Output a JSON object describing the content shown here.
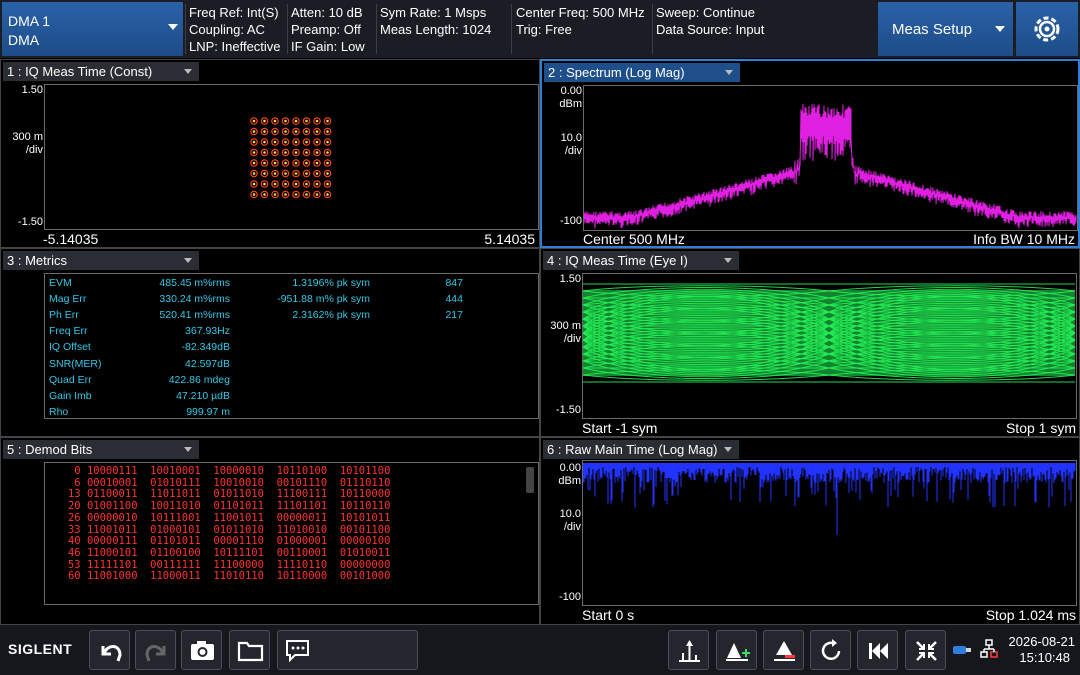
{
  "topbar": {
    "mode_line1": "DMA 1",
    "mode_line2": "DMA",
    "info": [
      [
        "Freq Ref: Int(S)",
        "Coupling: AC",
        "LNP: Ineffective"
      ],
      [
        "Atten: 10 dB",
        "Preamp: Off",
        "IF Gain: Low"
      ],
      [
        "Sym Rate: 1 Msps",
        "Meas Length: 1024"
      ],
      [
        "Center Freq: 500 MHz",
        "Trig: Free"
      ],
      [
        "Sweep: Continue",
        "Data Source: Input"
      ]
    ],
    "meas_setup": "Meas Setup",
    "gear_icon": "gear-icon"
  },
  "panels": {
    "p1": {
      "title": "1 : IQ Meas Time (Const)",
      "ytop": "1.50",
      "ydiv": "300 m",
      "ydivunit": "/div",
      "ybot": "-1.50",
      "xleft": "-5.14035",
      "xright": "5.14035"
    },
    "p2": {
      "title": "2 : Spectrum (Log Mag)",
      "ytop": "0.00",
      "ytopunit": "dBm",
      "ydiv": "10.0",
      "ydivunit": "/div",
      "ybot": "-100",
      "footleft": "Center 500 MHz",
      "footright": "Info BW 10 MHz"
    },
    "p3": {
      "title": "3 : Metrics"
    },
    "p4": {
      "title": "4 : IQ Meas Time (Eye I)",
      "ytop": "1.50",
      "ydiv": "300 m",
      "ydivunit": "/div",
      "ybot": "-1.50",
      "footleft": "Start -1 sym",
      "footright": "Stop 1 sym"
    },
    "p5": {
      "title": "5 : Demod Bits"
    },
    "p6": {
      "title": "6 : Raw Main Time (Log Mag)",
      "ytop": "0.00",
      "ytopunit": "dBm",
      "ydiv": "10.0",
      "ydivunit": "/div",
      "ybot": "-100",
      "footleft": "Start 0 s",
      "footright": "Stop 1.024 ms"
    }
  },
  "metrics": [
    [
      "EVM",
      "485.45 m%rms",
      "1.3196% pk sym",
      "847"
    ],
    [
      "Mag Err",
      "330.24 m%rms",
      "-951.88 m% pk sym",
      "444"
    ],
    [
      "Ph Err",
      "520.41 m%rms",
      "2.3162% pk sym",
      "217"
    ],
    [
      "Freq Err",
      "367.93Hz",
      "",
      ""
    ],
    [
      "IQ Offset",
      "-82.349dB",
      "",
      ""
    ],
    [
      "SNR(MER)",
      "42.597dB",
      "",
      ""
    ],
    [
      "Quad Err",
      "422.86 mdeg",
      "",
      ""
    ],
    [
      "Gain Imb",
      "47.210 µdB",
      "",
      ""
    ],
    [
      "Rho",
      "999.97 m",
      "",
      ""
    ]
  ],
  "bits": [
    [
      "0",
      "10000111",
      "10010001",
      "10000010",
      "10110100",
      "10101100"
    ],
    [
      "6",
      "00010001",
      "01010111",
      "10010010",
      "00101110",
      "01110110"
    ],
    [
      "13",
      "01100011",
      "11011011",
      "01011010",
      "11100111",
      "10110000"
    ],
    [
      "20",
      "01001100",
      "10011010",
      "01101011",
      "11101101",
      "10110110"
    ],
    [
      "26",
      "00000010",
      "10111001",
      "11001011",
      "00000011",
      "10101011"
    ],
    [
      "33",
      "11001011",
      "01000101",
      "01011010",
      "11010010",
      "00101100"
    ],
    [
      "40",
      "00000111",
      "01101011",
      "00001110",
      "01000001",
      "00000100"
    ],
    [
      "46",
      "11000101",
      "01100100",
      "10111101",
      "00110001",
      "01010011"
    ],
    [
      "53",
      "11111101",
      "00111111",
      "11100000",
      "11110110",
      "00000000"
    ],
    [
      "60",
      "11001000",
      "11000011",
      "11010110",
      "10110000",
      "00101000"
    ]
  ],
  "bottom": {
    "brand": "SIGLENT",
    "date": "2026-08-21",
    "time": "15:10:48"
  },
  "colors": {
    "accent": "#1e4f8a",
    "spectrum": "#e020e0",
    "eye": "#22ee55",
    "rawtime": "#2233ff",
    "metrics": "#33c8e8",
    "bits": "#ff3333"
  }
}
